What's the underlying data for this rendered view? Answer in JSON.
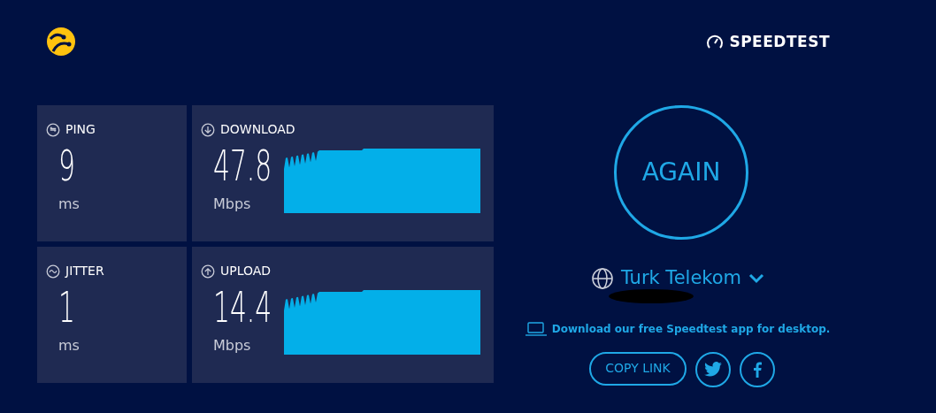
{
  "brand": {
    "name": "SPEEDTEST"
  },
  "metrics": [
    {
      "kind": "small",
      "label": "PING",
      "value": "9",
      "unit": "ms"
    },
    {
      "kind": "graph",
      "label": "DOWNLOAD",
      "value": "47.8",
      "unit": "Mbps"
    },
    {
      "kind": "small",
      "label": "JITTER",
      "value": "1",
      "unit": "ms"
    },
    {
      "kind": "graph",
      "label": "UPLOAD",
      "value": "14.4",
      "unit": "Mbps"
    }
  ],
  "again_button": {
    "label": "AGAIN"
  },
  "provider": {
    "name": "Turk Telekom"
  },
  "app_link": {
    "text": "Download our free Speedtest app for desktop."
  },
  "share": {
    "copy_label": "COPY LINK"
  }
}
